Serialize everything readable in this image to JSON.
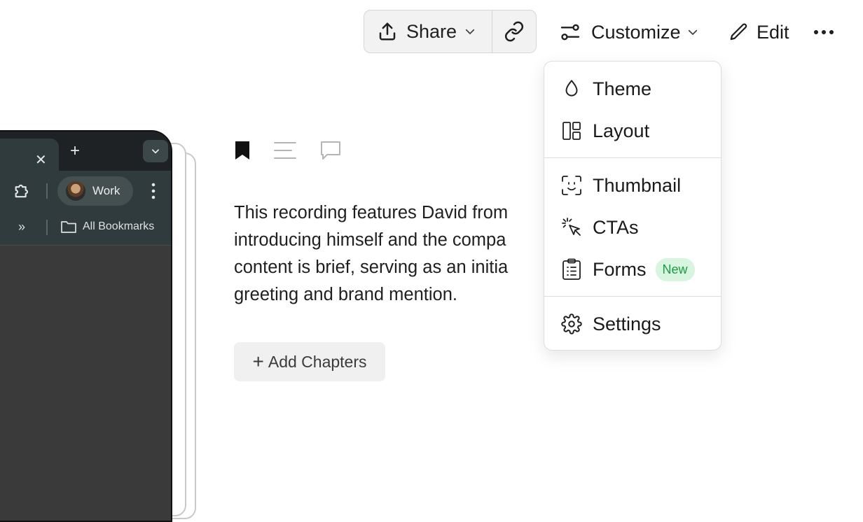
{
  "toolbar": {
    "share_label": "Share",
    "customize_label": "Customize",
    "edit_label": "Edit"
  },
  "browser_preview": {
    "profile_label": "Work",
    "bookmarks_label": "All Bookmarks"
  },
  "content": {
    "summary": "This recording features David from introducing himself and the compa content is brief, serving as an initia greeting and brand mention.",
    "summary_lines": [
      "This recording features David from",
      "introducing himself and the compa",
      "content is brief, serving as an initia",
      "greeting and brand mention."
    ],
    "add_chapters_label": "Add Chapters"
  },
  "customize_menu": {
    "items": [
      {
        "label": "Theme",
        "icon": "droplet-icon"
      },
      {
        "label": "Layout",
        "icon": "layout-icon"
      },
      {
        "label": "Thumbnail",
        "icon": "face-scan-icon"
      },
      {
        "label": "CTAs",
        "icon": "cursor-click-icon"
      },
      {
        "label": "Forms",
        "icon": "clipboard-icon",
        "badge": "New"
      },
      {
        "label": "Settings",
        "icon": "gear-icon"
      }
    ]
  },
  "colors": {
    "badge_bg": "#d7f5df",
    "badge_text": "#1e9a46",
    "browser_dark": "#2f3b3d"
  }
}
